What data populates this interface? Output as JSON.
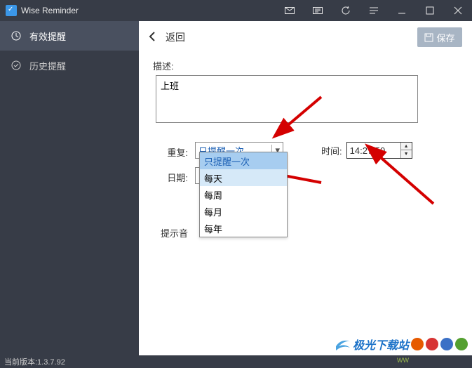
{
  "app": {
    "title": "Wise Reminder"
  },
  "sidebar": {
    "items": [
      {
        "label": "有效提醒"
      },
      {
        "label": "历史提醒"
      }
    ]
  },
  "toolbar": {
    "back_label": "返回",
    "save_label": "保存"
  },
  "form": {
    "desc_label": "描述:",
    "desc_value": "上班",
    "repeat_label": "重复:",
    "repeat_value": "只提醒一次",
    "repeat_options": [
      "只提醒一次",
      "每天",
      "每周",
      "每月",
      "每年"
    ],
    "date_label": "日期:",
    "time_label": "时间:",
    "time_value": "14:27:50",
    "sound_label": "提示音"
  },
  "status": {
    "version_label": "当前版本:1.3.7.92"
  },
  "watermark": {
    "text": "极光下载站",
    "sub": "WW"
  }
}
